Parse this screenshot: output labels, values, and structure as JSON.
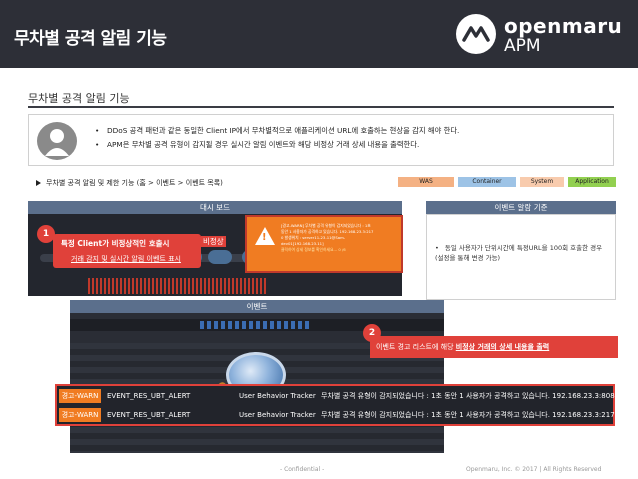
{
  "header": {
    "title": "무차별 공격 알림 기능",
    "logo_name": "openmaru",
    "logo_product": "APM"
  },
  "section": {
    "title": "무차별 공격 알림 기능"
  },
  "description": {
    "bullets": [
      "DDoS 공격 패턴과 같은 동일한 Client IP에서 무차별적으로 애플리케이션 URL에 호출하는 현상을 감지 해야 한다.",
      "APM은 무차별 공격 유형이 감지될 경우 실시간 알림 이벤트와 해당 비정상 거래 상세 내용을 출력한다."
    ]
  },
  "menu_path": "무차별 공격 알림 및 제한 기능 (홈 > 이벤트 > 이벤트 목록)",
  "tags": [
    "WAS",
    "Container",
    "System",
    "Application"
  ],
  "colors": {
    "header_bg": "#2d2f37",
    "callout_red": "#e0413a",
    "warn_orange": "#f07c22",
    "panel_bar": "#5b6f8c"
  },
  "dashboard": {
    "bar_title": "대시 보드"
  },
  "popup": {
    "lines": [
      "[경고-WARN] 무차별 공격 유형이 감지되었습니다 : 1초",
      "동안 1 사용자가 공격하고 있습니다. 192.168.23.3:217",
      "0 발생위치 : server11-23-11@Sam-",
      "dev01[192.168.23.11]",
      "클릭하여 상세 정보를 확인하세요... 0 /6"
    ]
  },
  "callout1": {
    "badge": "1",
    "line1_bold": "특정 Client가 비정상적인 호출시",
    "line1_tail": "비정상",
    "line2": "거래 감지 및 실시간 알림 이벤트 표시"
  },
  "event": {
    "bar_title": "이벤트"
  },
  "callout2": {
    "badge": "2",
    "text": "이벤트 경고 리스트에 해당",
    "text_bold": "비정상 거래의 상세 내용을 출력"
  },
  "criteria": {
    "bar_title": "이벤트 알람 기준",
    "text": "동일 사용자가 단위시간에 특정URL을 100회 호출한 경우 (설정을 통해 변경 가능)"
  },
  "zoom_rows": [
    {
      "level": "경고-WARN",
      "event": "EVENT_RES_UBT_ALERT",
      "source": "User Behavior Tracker",
      "message": "무차별 공격 유형이 감지되었습니다 : 1초 동안 1 사용자가 공격하고 있습니다. 192.168.23.3:808"
    },
    {
      "level": "경고-WARN",
      "event": "EVENT_RES_UBT_ALERT",
      "source": "User Behavior Tracker",
      "message": "무차별 공격 유형이 감지되었습니다 : 1초 동안 1 사용자가 공격하고 있습니다. 192.168.23.3:217"
    }
  ],
  "footer": {
    "confidential": "- Confidential -",
    "copyright": "Openmaru, Inc. © 2017 | All Rights Reserved"
  }
}
